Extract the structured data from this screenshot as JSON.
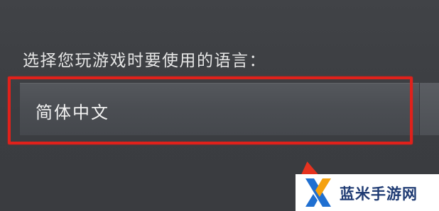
{
  "settings": {
    "prompt_label": "选择您玩游戏时要使用的语言：",
    "language_select": {
      "selected_value": "简体中文"
    }
  },
  "annotation": {
    "highlight_color": "#e0211b",
    "arrow_color": "#e6321f"
  },
  "watermark": {
    "text": "蓝米手游网",
    "logo_icon": "x-logo-icon",
    "colors": {
      "primary": "#1f6fd1",
      "accent": "#f5a10f",
      "text": "#1f3b73"
    }
  }
}
